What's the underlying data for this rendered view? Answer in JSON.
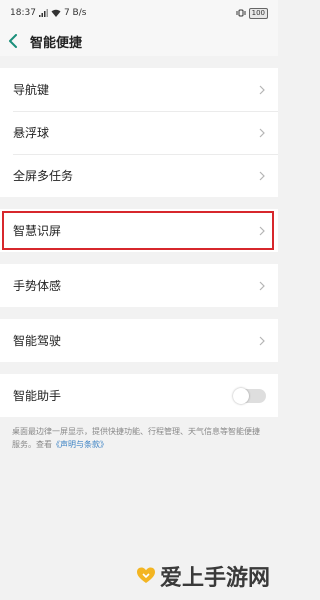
{
  "status_bar": {
    "time": "18:37",
    "network_speed": "7 B/s",
    "battery": "100"
  },
  "header": {
    "title": "智能便捷"
  },
  "groups": {
    "first": [
      "导航键",
      "悬浮球",
      "全屏多任务"
    ],
    "smart_screen": "智慧识屏",
    "gesture": "手势体感",
    "driving": "智能驾驶",
    "assistant": "智能助手"
  },
  "assistant_toggle": {
    "enabled": false
  },
  "description": {
    "text": "桌面最边律一屏显示，提供快捷功能、行程管理、天气信息等智能便捷服务。查看",
    "link": "《声明与条款》"
  },
  "watermark": {
    "text": "爱上手游网"
  },
  "colors": {
    "highlight": "#d7272c",
    "link": "#3b82c4",
    "background": "#f2f2f2"
  }
}
